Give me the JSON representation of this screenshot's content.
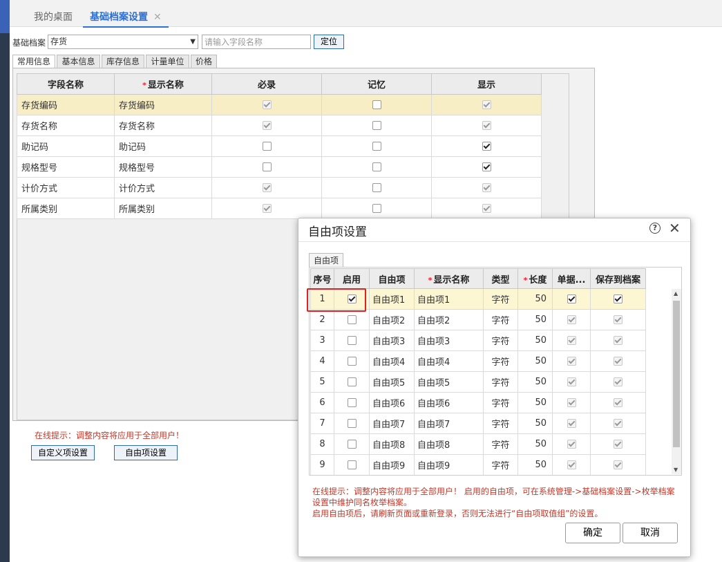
{
  "tabs": [
    {
      "label": "我的桌面"
    },
    {
      "label": "基础档案设置",
      "close": "✕"
    }
  ],
  "filter": {
    "label": "基础档案",
    "selected": "存货",
    "search_placeholder": "请输入字段名称",
    "locate_label": "定位"
  },
  "sub_tabs": [
    {
      "label": "常用信息"
    },
    {
      "label": "基本信息"
    },
    {
      "label": "库存信息"
    },
    {
      "label": "计量单位"
    },
    {
      "label": "价格"
    }
  ],
  "main_grid": {
    "headers": [
      "字段名称",
      "显示名称",
      "必录",
      "记忆",
      "显示"
    ],
    "rows": [
      {
        "field": "存货编码",
        "display": "存货编码",
        "required": {
          "checked": true,
          "disabled": true
        },
        "memory": {
          "checked": false,
          "disabled": false
        },
        "show": {
          "checked": true,
          "disabled": true
        }
      },
      {
        "field": "存货名称",
        "display": "存货名称",
        "required": {
          "checked": true,
          "disabled": true
        },
        "memory": {
          "checked": false,
          "disabled": false
        },
        "show": {
          "checked": true,
          "disabled": true
        }
      },
      {
        "field": "助记码",
        "display": "助记码",
        "required": {
          "checked": false,
          "disabled": false
        },
        "memory": {
          "checked": false,
          "disabled": false
        },
        "show": {
          "checked": true,
          "disabled": false
        }
      },
      {
        "field": "规格型号",
        "display": "规格型号",
        "required": {
          "checked": false,
          "disabled": false
        },
        "memory": {
          "checked": false,
          "disabled": false
        },
        "show": {
          "checked": true,
          "disabled": false
        }
      },
      {
        "field": "计价方式",
        "display": "计价方式",
        "required": {
          "checked": true,
          "disabled": true
        },
        "memory": {
          "checked": false,
          "disabled": false
        },
        "show": {
          "checked": true,
          "disabled": true
        }
      },
      {
        "field": "所属类别",
        "display": "所属类别",
        "required": {
          "checked": true,
          "disabled": true
        },
        "memory": {
          "checked": false,
          "disabled": false
        },
        "show": {
          "checked": true,
          "disabled": true
        }
      }
    ]
  },
  "bottom": {
    "tip": "在线提示：调整内容将应用于全部用户！",
    "custom_btn": "自定义项设置",
    "free_btn": "自由项设置"
  },
  "dialog": {
    "title": "自由项设置",
    "help_icon": "?",
    "close_icon": "✕",
    "tab": "自由项",
    "headers": [
      "序号",
      "启用",
      "自由项",
      "显示名称",
      "类型",
      "长度",
      "单据...",
      "保存到档案"
    ],
    "rows": [
      {
        "no": "1",
        "enabled": true,
        "item": "自由项1",
        "display": "自由项1",
        "type": "字符",
        "length": "50",
        "doc": {
          "checked": true,
          "disabled": false
        },
        "save": {
          "checked": true,
          "disabled": false
        }
      },
      {
        "no": "2",
        "enabled": false,
        "item": "自由项2",
        "display": "自由项2",
        "type": "字符",
        "length": "50",
        "doc": {
          "checked": true,
          "disabled": true
        },
        "save": {
          "checked": true,
          "disabled": true
        }
      },
      {
        "no": "3",
        "enabled": false,
        "item": "自由项3",
        "display": "自由项3",
        "type": "字符",
        "length": "50",
        "doc": {
          "checked": true,
          "disabled": true
        },
        "save": {
          "checked": true,
          "disabled": true
        }
      },
      {
        "no": "4",
        "enabled": false,
        "item": "自由项4",
        "display": "自由项4",
        "type": "字符",
        "length": "50",
        "doc": {
          "checked": true,
          "disabled": true
        },
        "save": {
          "checked": true,
          "disabled": true
        }
      },
      {
        "no": "5",
        "enabled": false,
        "item": "自由项5",
        "display": "自由项5",
        "type": "字符",
        "length": "50",
        "doc": {
          "checked": true,
          "disabled": true
        },
        "save": {
          "checked": true,
          "disabled": true
        }
      },
      {
        "no": "6",
        "enabled": false,
        "item": "自由项6",
        "display": "自由项6",
        "type": "字符",
        "length": "50",
        "doc": {
          "checked": true,
          "disabled": true
        },
        "save": {
          "checked": true,
          "disabled": true
        }
      },
      {
        "no": "7",
        "enabled": false,
        "item": "自由项7",
        "display": "自由项7",
        "type": "字符",
        "length": "50",
        "doc": {
          "checked": true,
          "disabled": true
        },
        "save": {
          "checked": true,
          "disabled": true
        }
      },
      {
        "no": "8",
        "enabled": false,
        "item": "自由项8",
        "display": "自由项8",
        "type": "字符",
        "length": "50",
        "doc": {
          "checked": true,
          "disabled": true
        },
        "save": {
          "checked": true,
          "disabled": true
        }
      },
      {
        "no": "9",
        "enabled": false,
        "item": "自由项9",
        "display": "自由项9",
        "type": "字符",
        "length": "50",
        "doc": {
          "checked": true,
          "disabled": true
        },
        "save": {
          "checked": true,
          "disabled": true
        }
      }
    ],
    "tip_line1": "在线提示：调整内容将应用于全部用户！ 启用的自由项，可在系统管理->基础档案设置->枚举档案设置中维护同名枚举档案。",
    "tip_line2": "启用自由项后，请刷新页面或重新登录，否则无法进行“自由项取值组”的设置。",
    "ok_label": "确定",
    "cancel_label": "取消"
  }
}
